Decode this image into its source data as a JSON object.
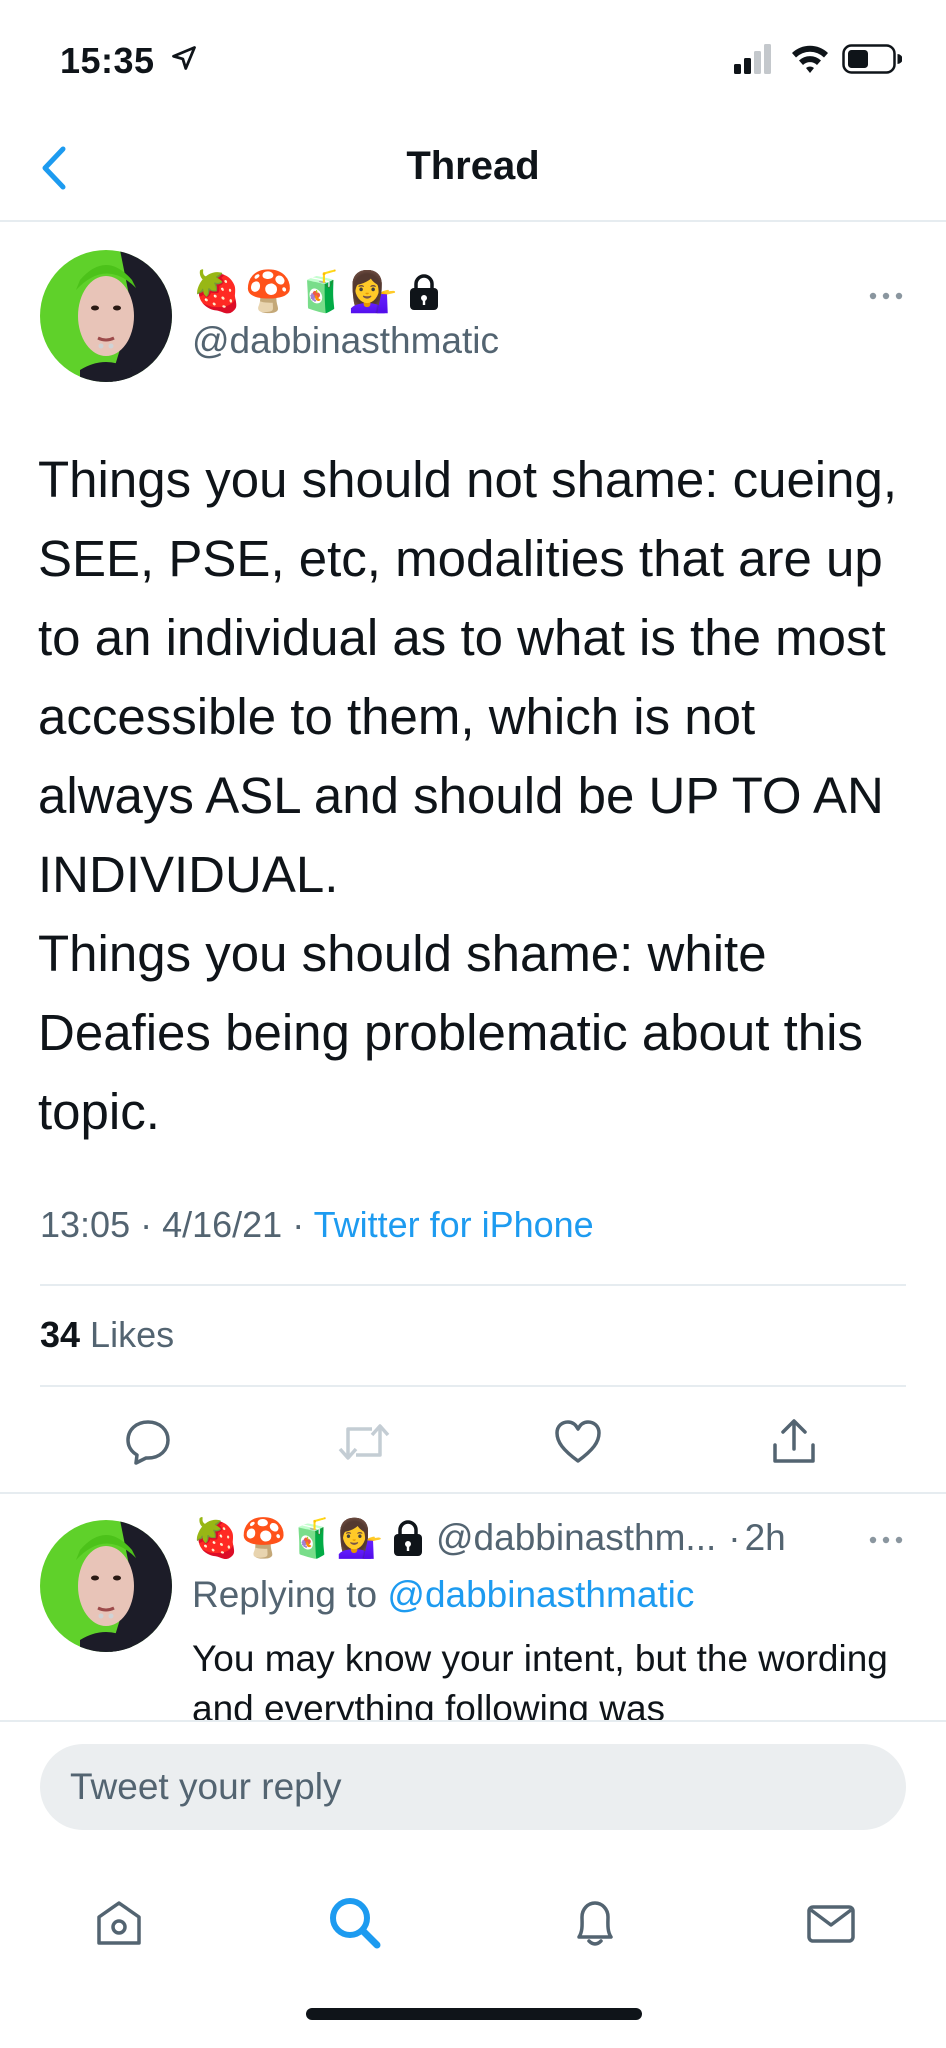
{
  "status_bar": {
    "time": "15:35"
  },
  "nav": {
    "title": "Thread"
  },
  "tweet": {
    "emojis": [
      "🍓",
      "🍄",
      "🧃",
      "💁‍♀️"
    ],
    "handle": "@dabbinasthmatic",
    "text": "Things you should not shame: cueing, SEE, PSE, etc, modalities that are up to an individual as to what is the most accessible to them, which is not always ASL and should be UP TO AN INDIVIDUAL.\nThings you should shame: white Deafies being problematic about this topic.",
    "time": "13:05",
    "date": "4/16/21",
    "separator": " · ",
    "source": "Twitter for iPhone",
    "likes_count": "34",
    "likes_label": " Likes"
  },
  "reply": {
    "emojis": [
      "🍓",
      "🍄",
      "🧃",
      "💁‍♀️"
    ],
    "handle": "@dabbinasthm...",
    "separator": "·",
    "time": "2h",
    "replying_prefix": "Replying to ",
    "replying_handle": "@dabbinasthmatic",
    "text": "You may know your intent, but the wording and everything following was"
  },
  "compose": {
    "placeholder": "Tweet your reply"
  },
  "icons": {
    "back": "chevron-left-icon",
    "more": "more-horizontal-icon",
    "lock": "lock-icon",
    "reply": "comment-icon",
    "retweet": "retweet-icon",
    "like": "heart-icon",
    "share": "share-icon",
    "home": "home-icon",
    "search": "search-icon",
    "notifications": "bell-icon",
    "messages": "mail-icon"
  },
  "colors": {
    "accent": "#1d9bf0",
    "secondary_text": "#536471",
    "avatar_hair": "#5fd12a"
  }
}
